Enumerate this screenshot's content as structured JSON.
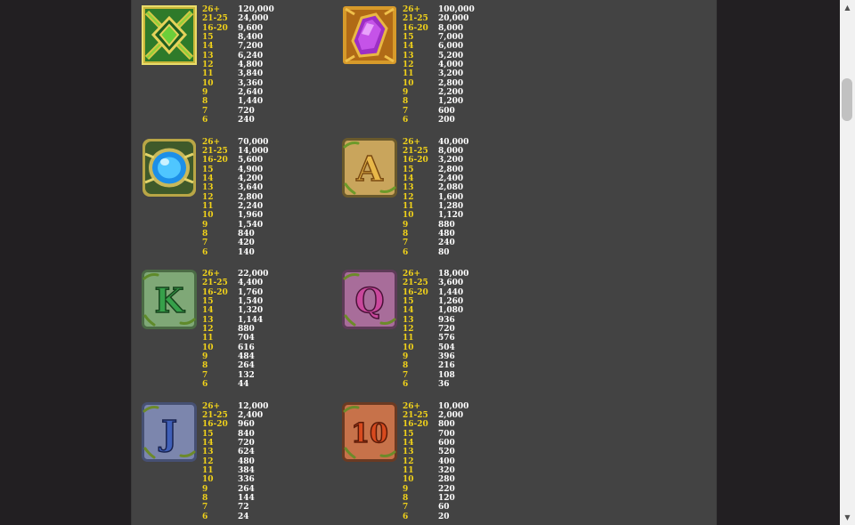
{
  "colors": {
    "count_color": "#f1d21a",
    "payout_color": "#ffffff",
    "panel_bg": "#434343",
    "page_bg": "#221f22"
  },
  "paytable": [
    {
      "symbol": "green-knot-icon",
      "rows": [
        {
          "count": "26+",
          "payout": "120,000"
        },
        {
          "count": "21-25",
          "payout": "24,000"
        },
        {
          "count": "16-20",
          "payout": "9,600"
        },
        {
          "count": "15",
          "payout": "8,400"
        },
        {
          "count": "14",
          "payout": "7,200"
        },
        {
          "count": "13",
          "payout": "6,240"
        },
        {
          "count": "12",
          "payout": "4,800"
        },
        {
          "count": "11",
          "payout": "3,840"
        },
        {
          "count": "10",
          "payout": "3,360"
        },
        {
          "count": "9",
          "payout": "2,640"
        },
        {
          "count": "8",
          "payout": "1,440"
        },
        {
          "count": "7",
          "payout": "720"
        },
        {
          "count": "6",
          "payout": "240"
        }
      ]
    },
    {
      "symbol": "purple-gem-icon",
      "rows": [
        {
          "count": "26+",
          "payout": "100,000"
        },
        {
          "count": "21-25",
          "payout": "20,000"
        },
        {
          "count": "16-20",
          "payout": "8,000"
        },
        {
          "count": "15",
          "payout": "7,000"
        },
        {
          "count": "14",
          "payout": "6,000"
        },
        {
          "count": "13",
          "payout": "5,200"
        },
        {
          "count": "12",
          "payout": "4,000"
        },
        {
          "count": "11",
          "payout": "3,200"
        },
        {
          "count": "10",
          "payout": "2,800"
        },
        {
          "count": "9",
          "payout": "2,200"
        },
        {
          "count": "8",
          "payout": "1,200"
        },
        {
          "count": "7",
          "payout": "600"
        },
        {
          "count": "6",
          "payout": "200"
        }
      ]
    },
    {
      "symbol": "blue-gem-icon",
      "rows": [
        {
          "count": "26+",
          "payout": "70,000"
        },
        {
          "count": "21-25",
          "payout": "14,000"
        },
        {
          "count": "16-20",
          "payout": "5,600"
        },
        {
          "count": "15",
          "payout": "4,900"
        },
        {
          "count": "14",
          "payout": "4,200"
        },
        {
          "count": "13",
          "payout": "3,640"
        },
        {
          "count": "12",
          "payout": "2,800"
        },
        {
          "count": "11",
          "payout": "2,240"
        },
        {
          "count": "10",
          "payout": "1,960"
        },
        {
          "count": "9",
          "payout": "1,540"
        },
        {
          "count": "8",
          "payout": "840"
        },
        {
          "count": "7",
          "payout": "420"
        },
        {
          "count": "6",
          "payout": "140"
        }
      ]
    },
    {
      "symbol": "letter-a-icon",
      "letter": "A",
      "rows": [
        {
          "count": "26+",
          "payout": "40,000"
        },
        {
          "count": "21-25",
          "payout": "8,000"
        },
        {
          "count": "16-20",
          "payout": "3,200"
        },
        {
          "count": "15",
          "payout": "2,800"
        },
        {
          "count": "14",
          "payout": "2,400"
        },
        {
          "count": "13",
          "payout": "2,080"
        },
        {
          "count": "12",
          "payout": "1,600"
        },
        {
          "count": "11",
          "payout": "1,280"
        },
        {
          "count": "10",
          "payout": "1,120"
        },
        {
          "count": "9",
          "payout": "880"
        },
        {
          "count": "8",
          "payout": "480"
        },
        {
          "count": "7",
          "payout": "240"
        },
        {
          "count": "6",
          "payout": "80"
        }
      ]
    },
    {
      "symbol": "letter-k-icon",
      "letter": "K",
      "rows": [
        {
          "count": "26+",
          "payout": "22,000"
        },
        {
          "count": "21-25",
          "payout": "4,400"
        },
        {
          "count": "16-20",
          "payout": "1,760"
        },
        {
          "count": "15",
          "payout": "1,540"
        },
        {
          "count": "14",
          "payout": "1,320"
        },
        {
          "count": "13",
          "payout": "1,144"
        },
        {
          "count": "12",
          "payout": "880"
        },
        {
          "count": "11",
          "payout": "704"
        },
        {
          "count": "10",
          "payout": "616"
        },
        {
          "count": "9",
          "payout": "484"
        },
        {
          "count": "8",
          "payout": "264"
        },
        {
          "count": "7",
          "payout": "132"
        },
        {
          "count": "6",
          "payout": "44"
        }
      ]
    },
    {
      "symbol": "letter-q-icon",
      "letter": "Q",
      "rows": [
        {
          "count": "26+",
          "payout": "18,000"
        },
        {
          "count": "21-25",
          "payout": "3,600"
        },
        {
          "count": "16-20",
          "payout": "1,440"
        },
        {
          "count": "15",
          "payout": "1,260"
        },
        {
          "count": "14",
          "payout": "1,080"
        },
        {
          "count": "13",
          "payout": "936"
        },
        {
          "count": "12",
          "payout": "720"
        },
        {
          "count": "11",
          "payout": "576"
        },
        {
          "count": "10",
          "payout": "504"
        },
        {
          "count": "9",
          "payout": "396"
        },
        {
          "count": "8",
          "payout": "216"
        },
        {
          "count": "7",
          "payout": "108"
        },
        {
          "count": "6",
          "payout": "36"
        }
      ]
    },
    {
      "symbol": "letter-j-icon",
      "letter": "J",
      "rows": [
        {
          "count": "26+",
          "payout": "12,000"
        },
        {
          "count": "21-25",
          "payout": "2,400"
        },
        {
          "count": "16-20",
          "payout": "960"
        },
        {
          "count": "15",
          "payout": "840"
        },
        {
          "count": "14",
          "payout": "720"
        },
        {
          "count": "13",
          "payout": "624"
        },
        {
          "count": "12",
          "payout": "480"
        },
        {
          "count": "11",
          "payout": "384"
        },
        {
          "count": "10",
          "payout": "336"
        },
        {
          "count": "9",
          "payout": "264"
        },
        {
          "count": "8",
          "payout": "144"
        },
        {
          "count": "7",
          "payout": "72"
        },
        {
          "count": "6",
          "payout": "24"
        }
      ]
    },
    {
      "symbol": "number-10-icon",
      "letter": "10",
      "rows": [
        {
          "count": "26+",
          "payout": "10,000"
        },
        {
          "count": "21-25",
          "payout": "2,000"
        },
        {
          "count": "16-20",
          "payout": "800"
        },
        {
          "count": "15",
          "payout": "700"
        },
        {
          "count": "14",
          "payout": "600"
        },
        {
          "count": "13",
          "payout": "520"
        },
        {
          "count": "12",
          "payout": "400"
        },
        {
          "count": "11",
          "payout": "320"
        },
        {
          "count": "10",
          "payout": "280"
        },
        {
          "count": "9",
          "payout": "220"
        },
        {
          "count": "8",
          "payout": "120"
        },
        {
          "count": "7",
          "payout": "60"
        },
        {
          "count": "6",
          "payout": "20"
        }
      ]
    }
  ]
}
